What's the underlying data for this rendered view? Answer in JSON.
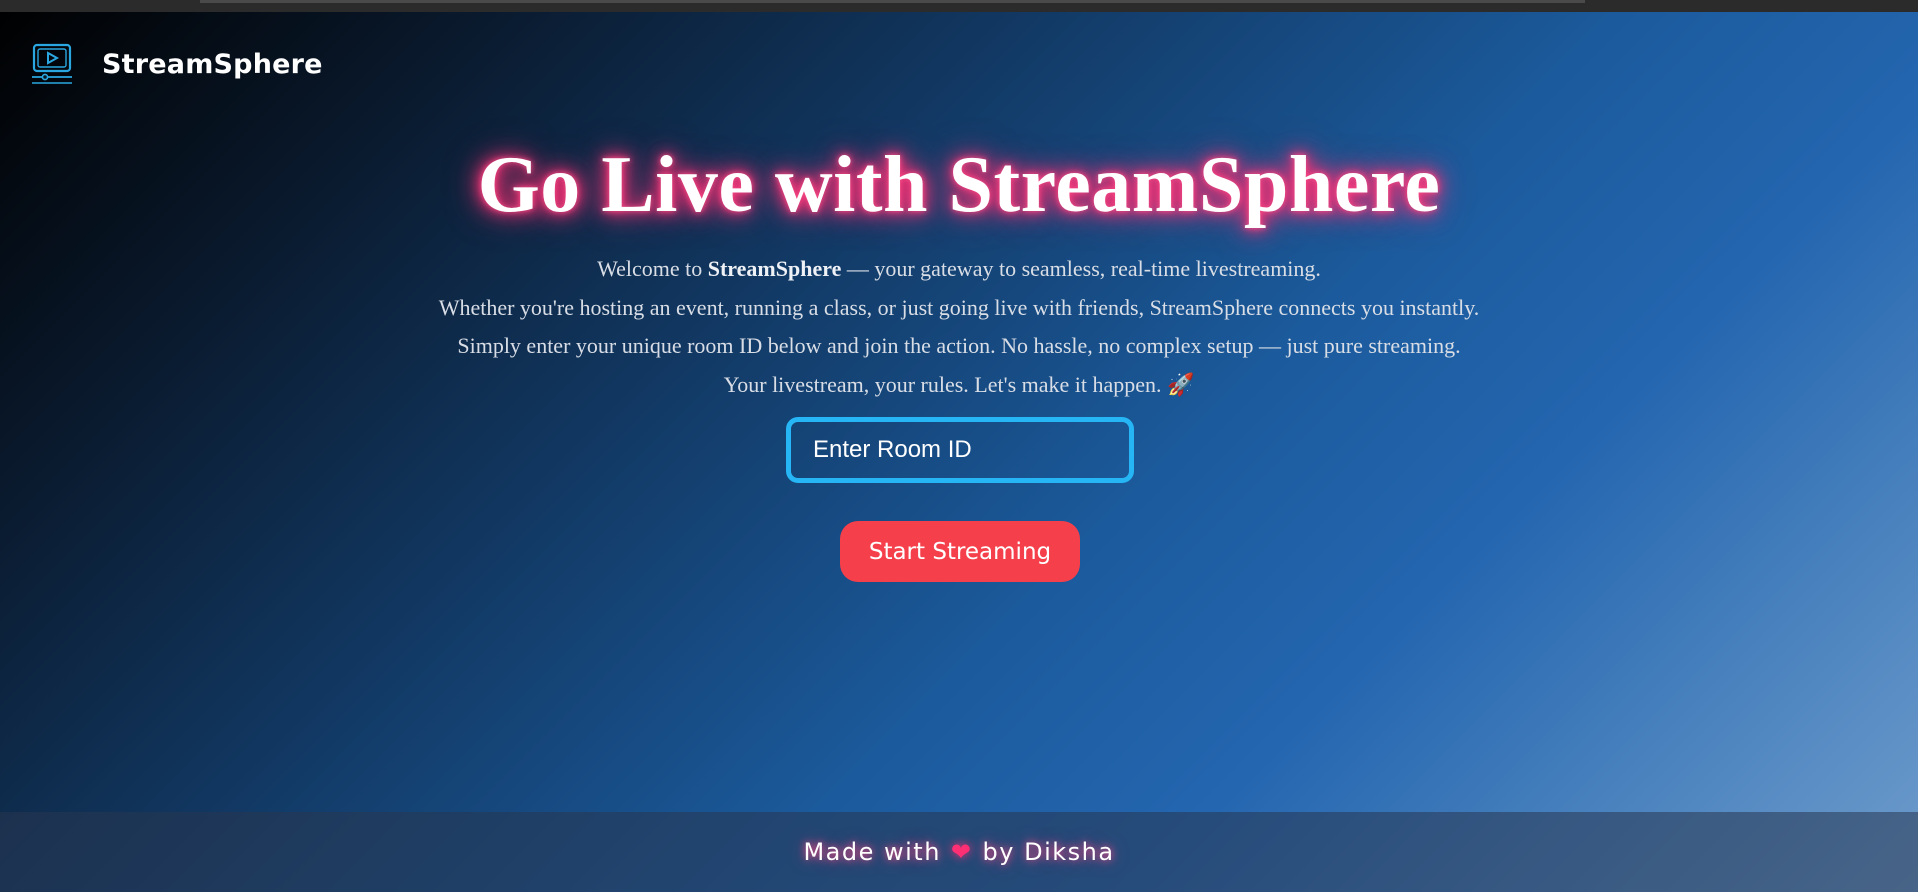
{
  "header": {
    "brand": "StreamSphere",
    "logo_icon": "video-play-icon"
  },
  "hero": {
    "title": "Go Live with StreamSphere",
    "line1_prefix": "Welcome to ",
    "line1_brand": "StreamSphere",
    "line1_suffix": " — your gateway to seamless, real-time livestreaming.",
    "line2": "Whether you're hosting an event, running a class, or just going live with friends, StreamSphere connects you instantly.",
    "line3": "Simply enter your unique room ID below and join the action. No hassle, no complex setup — just pure streaming.",
    "line4": "Your livestream, your rules. Let's make it happen. 🚀"
  },
  "form": {
    "room_placeholder": "Enter Room ID",
    "room_value": "",
    "start_label": "Start Streaming"
  },
  "footer": {
    "prefix": "Made with",
    "heart": "❤",
    "suffix": "by Diksha"
  },
  "colors": {
    "title_glow": "#ff2f74",
    "input_border": "#26b6f5",
    "button_bg": "#f5404b",
    "logo_stroke": "#2aa7e0"
  }
}
